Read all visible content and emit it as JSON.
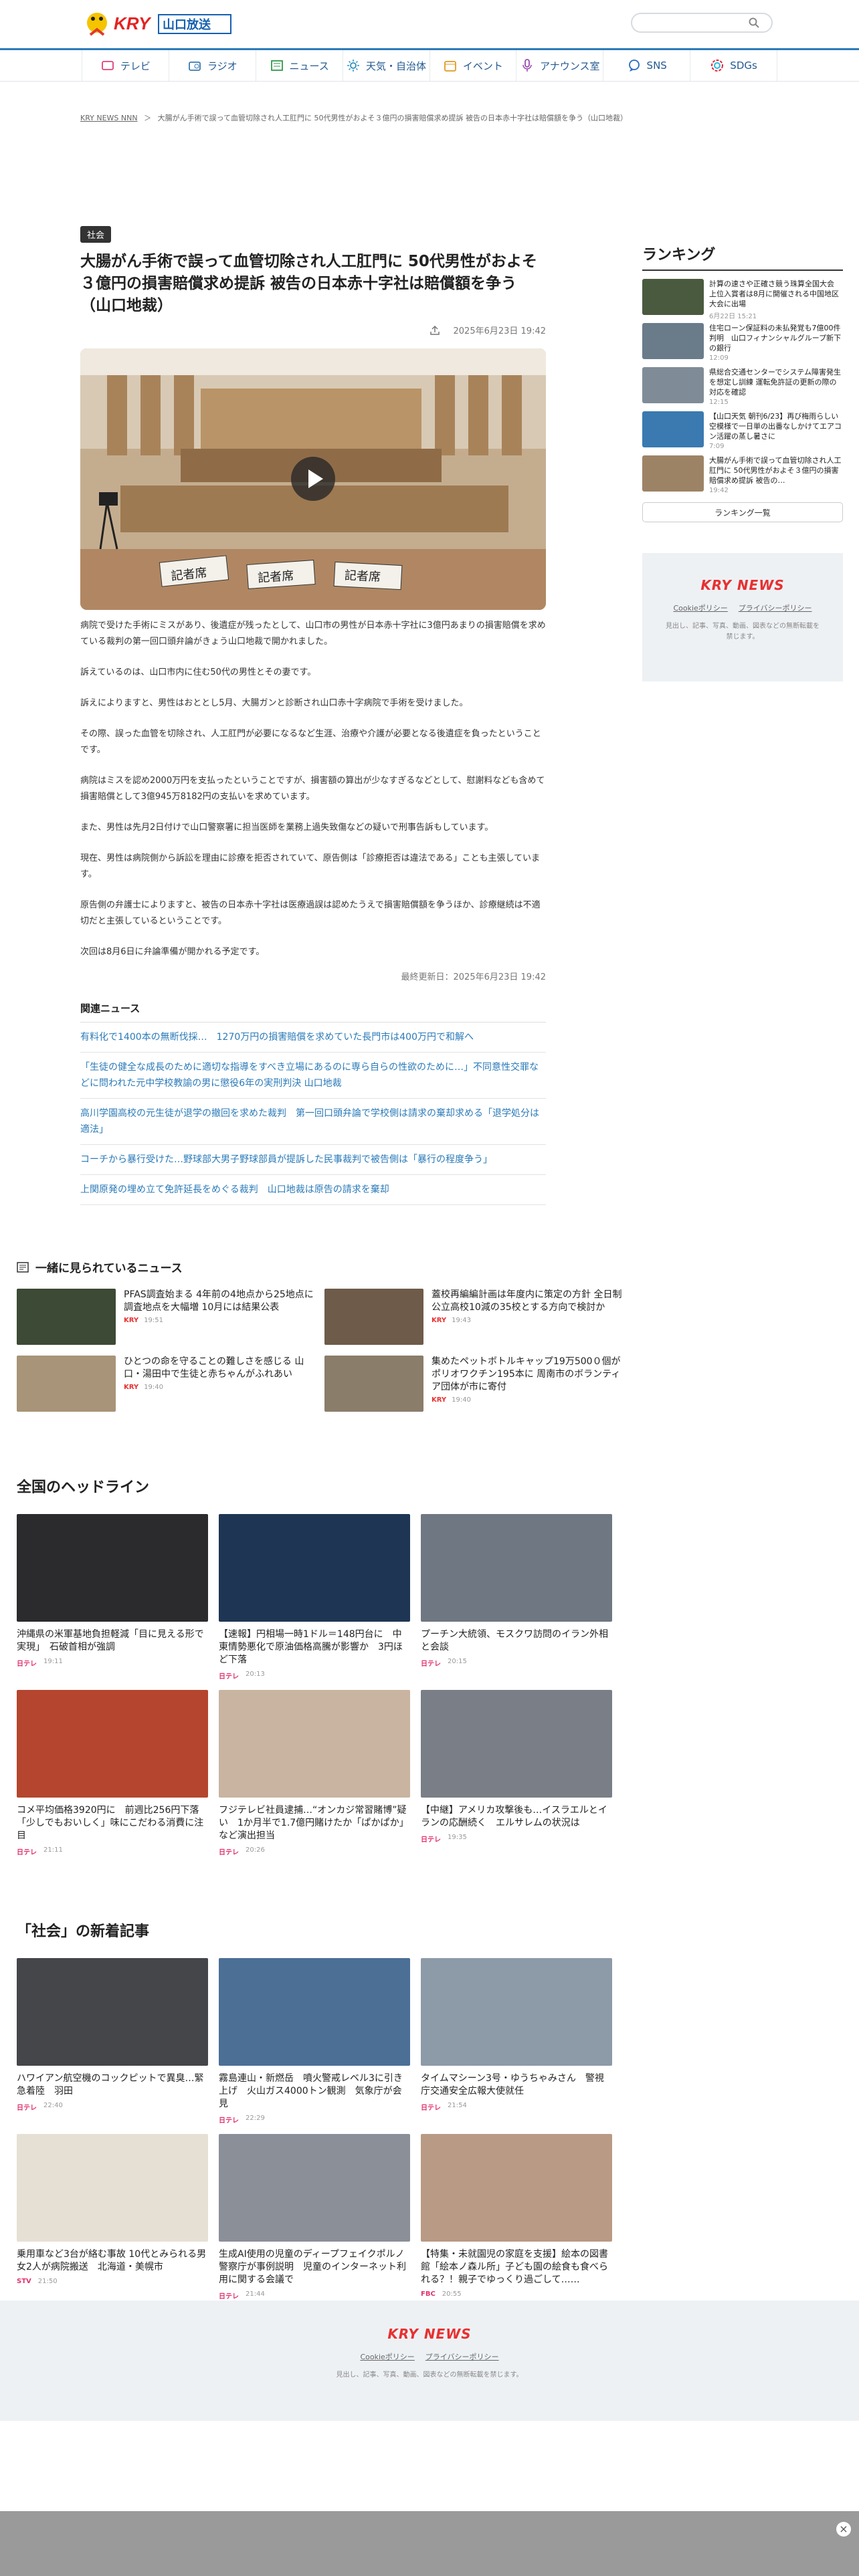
{
  "header": {
    "logo_alt": "KRY山口放送",
    "search_placeholder": ""
  },
  "nav": [
    {
      "label": "テレビ",
      "icon": "tv-icon"
    },
    {
      "label": "ラジオ",
      "icon": "radio-icon"
    },
    {
      "label": "ニュース",
      "icon": "news-icon"
    },
    {
      "label": "天気・自治体",
      "icon": "sun-icon"
    },
    {
      "label": "イベント",
      "icon": "calendar-icon"
    },
    {
      "label": "アナウンス室",
      "icon": "microphone-icon"
    },
    {
      "label": "SNS",
      "icon": "chat-icon"
    },
    {
      "label": "SDGs",
      "icon": "sdgs-icon"
    }
  ],
  "breadcrumb": [
    "KRY NEWS NNN",
    "＞",
    "大腸がん手術で誤って血管切除され人工肛門に 50代男性がおよそ３億円の損害賠償求め提訴 被告の日本赤十字社は賠償額を争う（山口地裁）"
  ],
  "article": {
    "tag": "社会",
    "title": "大腸がん手術で誤って血管切除され人工肛門に 50代男性がおよそ３億円の損害賠償求め提訴 被告の日本赤十字社は賠償額を争う（山口地裁）",
    "date": "2025年6月23日 19:42",
    "paragraphs": [
      "病院で受けた手術にミスがあり、後遺症が残ったとして、山口市の男性が日本赤十字社に3億円あまりの損害賠償を求めている裁判の第一回口頭弁論がきょう山口地裁で開かれました。",
      "訴えているのは、山口市内に住む50代の男性とその妻です。",
      "訴えによりますと、男性はおととし5月、大腸ガンと診断され山口赤十字病院で手術を受けました。",
      "その際、誤った血管を切除され、人工肛門が必要になるなど生涯、治療や介護が必要となる後遺症を負ったということです。",
      "病院はミスを認め2000万円を支払ったということですが、損害額の算出が少なすぎるなどとして、慰謝料なども含めて損害賠償として3億945万8182円の支払いを求めています。",
      "また、男性は先月2日付けで山口警察署に担当医師を業務上過失致傷などの疑いで刑事告訴もしています。",
      "現在、男性は病院側から訴訟を理由に診療を拒否されていて、原告側は「診療拒否は違法である」ことも主張しています。",
      "原告側の弁護士によりますと、被告の日本赤十字社は医療過誤は認めたうえで損害賠償額を争うほか、診療継続は不適切だと主張しているということです。",
      "次回は8月6日に弁論準備が開かれる予定です。"
    ],
    "updated": "最終更新日：2025年6月23日 19:42"
  },
  "related": {
    "heading": "関連ニュース",
    "items": [
      "有料化で1400本の無断伐採…　1270万円の損害賠償を求めていた長門市は400万円で和解へ",
      "「生徒の健全な成長のために適切な指導をすべき立場にあるのに専ら自らの性欲のために…」不同意性交罪などに問われた元中学校教諭の男に懲役6年の実刑判決 山口地裁",
      "高川学園高校の元生徒が退学の撤回を求めた裁判　第一回口頭弁論で学校側は請求の棄却求める「退学処分は適法」",
      "コーチから暴行受けた…野球部大男子野球部員が提訴した民事裁判で被告側は「暴行の程度争う」",
      "上関原発の埋め立て免許延長をめぐる裁判　山口地裁は原告の請求を棄却"
    ]
  },
  "ranking": {
    "heading": "ランキング",
    "items": [
      {
        "title": "計算の速さや正確さ競う珠算全国大会 上位入賞者は8月に開催される中国地区大会に出場",
        "time": "6月22日 15:21",
        "thumb": "#4a5a3e"
      },
      {
        "title": "住宅ローン保証料の未払発覚も7億00件判明　山口フィナンシャルグループ新下の銀行",
        "time": "12:09",
        "thumb": "#6a7b8a"
      },
      {
        "title": "県総合交通センターでシステム障害発生を想定し訓練 運転免許証の更新の際の対応を確認",
        "time": "12:15",
        "thumb": "#7f8c97"
      },
      {
        "title": "【山口天気 朝刊6/23】再び梅雨らしい空模様で一日単の出番なしかけてエアコン活躍の蒸し暑さに",
        "time": "7:09",
        "thumb": "#3a7ab0"
      },
      {
        "title": "大腸がん手術で誤って血管切除され人工肛門に 50代男性がおよそ３億円の損害賠償求め提訴 被告の…",
        "time": "19:42",
        "thumb": "#9d8366"
      }
    ],
    "more": "ランキング一覧"
  },
  "side_footer": {
    "brand": "KRY NEWS",
    "cookie": "Cookieポリシー",
    "privacy": "プライバシーポリシー",
    "copyright": "見出し、記事、写真、動画、図表などの無断転載を禁じます。"
  },
  "also_watched": {
    "heading": "一緒に見られているニュース",
    "items": [
      {
        "title": "PFAS調査始まる 4年前の4地点から25地点に調査地点を大幅増 10月には結果公表",
        "src": "KRY",
        "time": "19:51",
        "thumb": "#3d4a35"
      },
      {
        "title": "蓋校再編編計画は年度内に策定の方針 全日制公立高校10減の35校とする方向で検討か",
        "src": "KRY",
        "time": "19:43",
        "thumb": "#6e5b4a"
      },
      {
        "title": "ひとつの命を守ることの難しさを感じる 山口・湯田中で生徒と赤ちゃんがふれあい",
        "src": "KRY",
        "time": "19:40",
        "thumb": "#a89478"
      },
      {
        "title": "集めたペットボトルキャップ19万500０個がポリオワクチン195本に 周南市のボランティア団体が市に寄付",
        "src": "KRY",
        "time": "19:40",
        "thumb": "#8a7d6a"
      }
    ]
  },
  "headlines": {
    "heading": "全国のヘッドライン",
    "items": [
      {
        "title": "沖縄県の米軍基地負担軽減「目に見える形で実現」　石破首相が強調",
        "src": "日テレ",
        "time": "19:11",
        "thumb": "#2b2b2e"
      },
      {
        "title": "【速報】円相場一時1ドル＝148円台に　中東情勢悪化で原油価格高騰が影響か　3円ほど下落",
        "src": "日テレ",
        "time": "20:13",
        "thumb": "#1e3654"
      },
      {
        "title": "プーチン大統領、モスクワ訪問のイラン外相と会談",
        "src": "日テレ",
        "time": "20:15",
        "thumb": "#6f7782"
      },
      {
        "title": "コメ平均価格3920円に　前週比256円下落「少しでもおいしく」味にこだわる消費に注目",
        "src": "日テレ",
        "time": "21:11",
        "thumb": "#b5452e"
      },
      {
        "title": "フジテレビ社員逮捕…“オンカジ常習賭博”疑い　1か月半で1.7億円賭けたか「ぱかぱか」など演出担当",
        "src": "日テレ",
        "time": "20:26",
        "thumb": "#c8b4a0"
      },
      {
        "title": "【中継】アメリカ攻撃後も…イスラエルとイランの応酬続く　エルサレムの状況は",
        "src": "日テレ",
        "time": "19:35",
        "thumb": "#7a7e86"
      }
    ]
  },
  "latest": {
    "heading": "「社会」の新着記事",
    "items": [
      {
        "title": "ハワイアン航空機のコックピットで異臭…緊急着陸　羽田",
        "src": "日テレ",
        "time": "22:40",
        "thumb": "#45464a"
      },
      {
        "title": "霧島連山・新燃岳　噴火警戒レベル3に引き上げ　火山ガス4000トン観測　気象庁が会見",
        "src": "日テレ",
        "time": "22:29",
        "thumb": "#4c6f96"
      },
      {
        "title": "タイムマシーン3号・ゆうちゃみさん　警視庁交通安全広報大使就任",
        "src": "日テレ",
        "time": "21:54",
        "thumb": "#8d9aa8"
      },
      {
        "title": "乗用車など3台が絡む事故 10代とみられる男女2人が病院搬送　北海道・美幌市",
        "src": "STV",
        "time": "21:50",
        "thumb": "#e6e0d4"
      },
      {
        "title": "生成AI使用の児童のディープフェイクポルノ　警察庁が事例説明　児童のインターネット利用に関する会議で",
        "src": "日テレ",
        "time": "21:44",
        "thumb": "#8a8f98"
      },
      {
        "title": "【特集・未就園児の家庭を支援】絵本の図書館「絵本ノ森ル所」子ども園の絵食も食べられる？！親子でゆっくり過ごして……",
        "src": "FBC",
        "time": "20:55",
        "thumb": "#b99a84"
      }
    ]
  },
  "footer": {
    "brand": "KRY NEWS",
    "cookie": "Cookieポリシー",
    "privacy": "プライバシーポリシー",
    "copyright": "見出し、記事、写真、動画、図表などの無断転載を禁じます。"
  }
}
